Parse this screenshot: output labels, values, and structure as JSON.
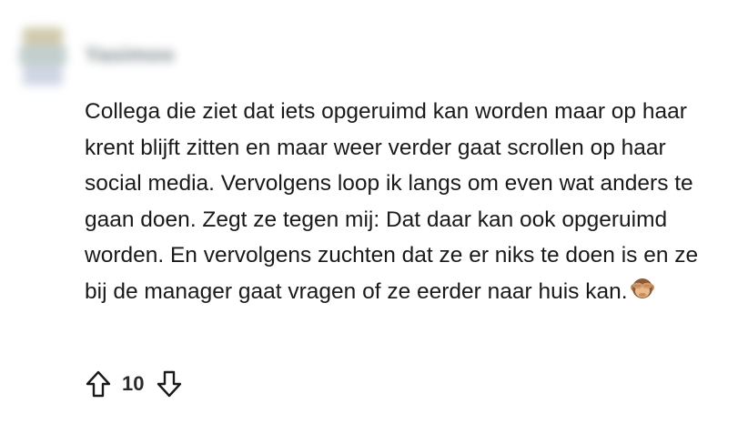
{
  "comment": {
    "author": "Yasimoo",
    "body": "Collega die ziet dat iets opgeruimd kan worden maar op haar krent blijft zitten en maar weer verder gaat scrollen op haar social media. Vervolgens loop ik langs om even wat anders te gaan doen. Zegt ze tegen mij: Dat daar kan ook opgeruimd worden. En vervolgens zuchten dat ze er niks te doen is en ze bij de manager gaat vragen of ze eerder naar huis kan.",
    "emoji": "see-no-evil-monkey-icon",
    "score": "10"
  },
  "colors": {
    "text": "#1a1a1b",
    "icon": "#1a1a1b",
    "username": "#5f6b70"
  }
}
